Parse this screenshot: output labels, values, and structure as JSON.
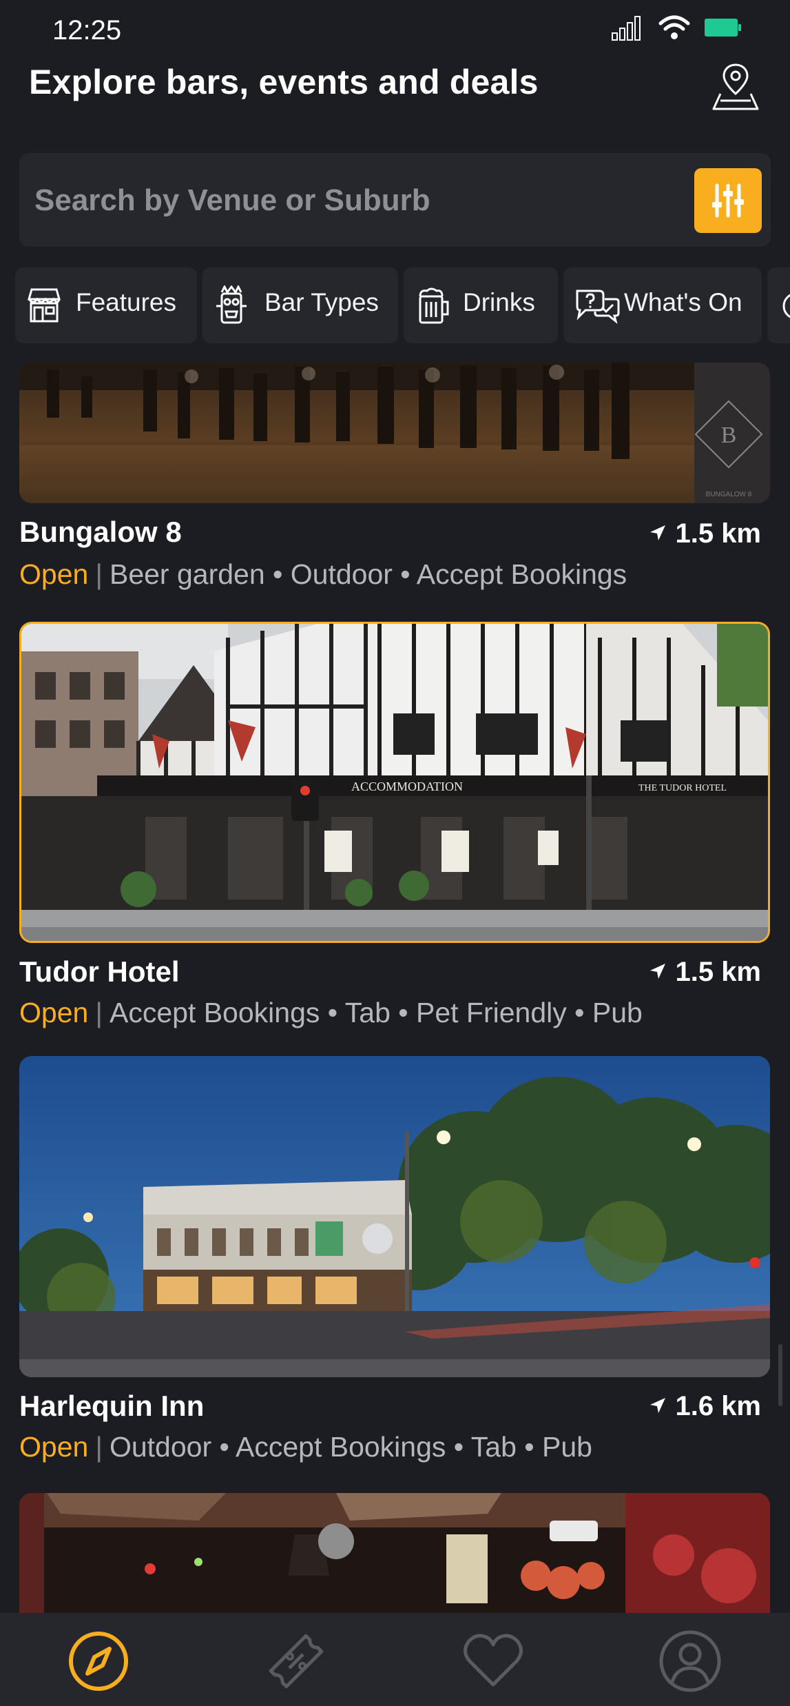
{
  "status": {
    "time": "12:25"
  },
  "header": {
    "title": "Explore bars, events and deals",
    "map_icon": "map-pin-icon"
  },
  "search": {
    "placeholder": "Search by Venue or Suburb",
    "value": "",
    "filter_icon": "sliders-icon"
  },
  "colors": {
    "accent": "#f9ae1f",
    "background": "#1c1d22",
    "surface": "#26272d",
    "battery": "#1ec992"
  },
  "categories": [
    {
      "label": "Features",
      "icon": "storefront-icon"
    },
    {
      "label": "Bar Types",
      "icon": "tiki-icon"
    },
    {
      "label": "Drinks",
      "icon": "beer-mug-icon"
    },
    {
      "label": "What's On",
      "icon": "chat-question-icon"
    }
  ],
  "venues": [
    {
      "name": "Bungalow 8",
      "distance": "1.5 km",
      "status": "Open",
      "tags": "Beer garden • Outdoor • Accept Bookings",
      "watermark": "BUNGALOW 8"
    },
    {
      "name": "Tudor Hotel",
      "distance": "1.5 km",
      "status": "Open",
      "tags": "Accept Bookings • Tab • Pet Friendly • Pub",
      "sign_accommodation": "ACCOMMODATION",
      "sign_name": "THE TUDOR HOTEL",
      "selected": true
    },
    {
      "name": "Harlequin Inn",
      "distance": "1.6 km",
      "status": "Open",
      "tags": "Outdoor • Accept Bookings • Tab • Pub"
    }
  ],
  "tabs": [
    {
      "icon": "compass-icon",
      "active": true
    },
    {
      "icon": "ticket-percent-icon",
      "active": false
    },
    {
      "icon": "heart-icon",
      "active": false
    },
    {
      "icon": "user-circle-icon",
      "active": false
    }
  ]
}
